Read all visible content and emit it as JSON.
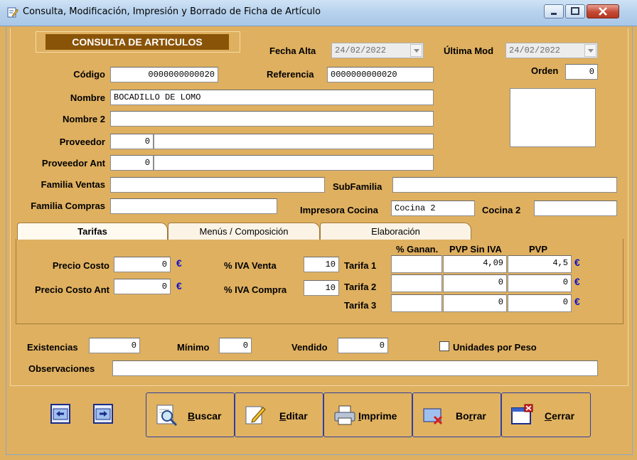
{
  "window": {
    "title": "Consulta, Modificación, Impresión y Borrado de Ficha de Artículo"
  },
  "header": {
    "title": "CONSULTA DE ARTICULOS"
  },
  "dates": {
    "fecha_alta_label": "Fecha Alta",
    "fecha_alta_value": "24/02/2022",
    "ultima_mod_label": "Última Mod",
    "ultima_mod_value": "24/02/2022"
  },
  "fields": {
    "codigo_label": "Código",
    "codigo_value": "0000000000020",
    "referencia_label": "Referencia",
    "referencia_value": "0000000000020",
    "orden_label": "Orden",
    "orden_value": "0",
    "nombre_label": "Nombre",
    "nombre_value": "BOCADILLO DE LOMO",
    "nombre2_label": "Nombre 2",
    "nombre2_value": "",
    "proveedor_label": "Proveedor",
    "proveedor_code": "0",
    "proveedor_name": "",
    "proveedor_ant_label": "Proveedor Ant",
    "proveedor_ant_code": "0",
    "proveedor_ant_name": "",
    "familia_ventas_label": "Familia Ventas",
    "familia_ventas_value": "",
    "subfamilia_label": "SubFamilia",
    "subfamilia_value": "",
    "familia_compras_label": "Familia Compras",
    "familia_compras_value": "",
    "impresora_cocina_label": "Impresora Cocina",
    "impresora_cocina_value": "Cocina 2",
    "cocina2_label": "Cocina 2",
    "cocina2_value": ""
  },
  "tabs": [
    {
      "label": "Tarifas"
    },
    {
      "label": "Menús / Composición"
    },
    {
      "label": "Elaboración"
    }
  ],
  "tarifas": {
    "precio_costo_label": "Precio Costo",
    "precio_costo_value": "0",
    "precio_costo_ant_label": "Precio Costo Ant",
    "precio_costo_ant_value": "0",
    "iva_venta_label": "% IVA Venta",
    "iva_venta_value": "10",
    "iva_compra_label": "% IVA Compra",
    "iva_compra_value": "10",
    "col_ganancia": "% Ganan.",
    "col_pvp_sin_iva": "PVP Sin IVA",
    "col_pvp": "PVP",
    "euro": "€",
    "rows": [
      {
        "label": "Tarifa 1",
        "ganancia": "",
        "pvp_sin_iva": "4,09",
        "pvp": "4,5"
      },
      {
        "label": "Tarifa 2",
        "ganancia": "",
        "pvp_sin_iva": "0",
        "pvp": "0"
      },
      {
        "label": "Tarifa 3",
        "ganancia": "",
        "pvp_sin_iva": "0",
        "pvp": "0"
      }
    ]
  },
  "stock": {
    "existencias_label": "Existencias",
    "existencias_value": "0",
    "minimo_label": "Mínimo",
    "minimo_value": "0",
    "vendido_label": "Vendido",
    "vendido_value": "0",
    "unidades_peso_label": "Unidades por Peso",
    "unidades_peso_checked": false,
    "observaciones_label": "Observaciones",
    "observaciones_value": ""
  },
  "buttons": {
    "buscar_pre": "",
    "buscar_key": "B",
    "buscar_post": "uscar",
    "editar_pre": "",
    "editar_key": "E",
    "editar_post": "ditar",
    "imprime_pre": "",
    "imprime_key": "I",
    "imprime_post": "mprime",
    "borrar_pre": "Bo",
    "borrar_key": "r",
    "borrar_post": "rar",
    "cerrar_pre": "",
    "cerrar_key": "C",
    "cerrar_post": "errar"
  },
  "colors": {
    "form_bg": "#dfb060",
    "header_bg": "#8a5408",
    "euro": "#1212c8",
    "button_border": "#2f3fa2"
  }
}
